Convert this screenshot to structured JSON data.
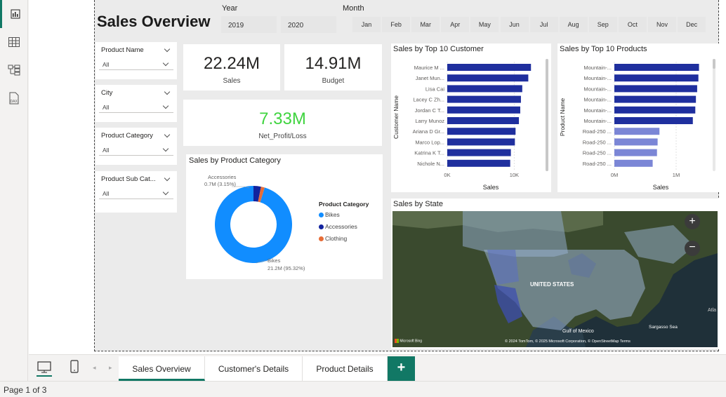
{
  "title": "Sales Overview",
  "year_filter": {
    "label": "Year",
    "options": [
      "2019",
      "2020"
    ]
  },
  "month_filter": {
    "label": "Month",
    "options": [
      "Jan",
      "Feb",
      "Mar",
      "Apr",
      "May",
      "Jun",
      "Jul",
      "Aug",
      "Sep",
      "Oct",
      "Nov",
      "Dec"
    ]
  },
  "slicers": [
    {
      "label": "Product Name",
      "value": "All"
    },
    {
      "label": "City",
      "value": "All"
    },
    {
      "label": "Product Category",
      "value": "All"
    },
    {
      "label": "Product Sub Cat...",
      "value": "All"
    }
  ],
  "kpis": {
    "sales": {
      "value": "22.24M",
      "label": "Sales"
    },
    "budget": {
      "value": "14.91M",
      "label": "Budget"
    },
    "profit": {
      "value": "7.33M",
      "label": "Net_Profit/Loss",
      "color": "#3fd43f"
    }
  },
  "donut": {
    "title": "Sales by Product Category",
    "legend_title": "Product Category",
    "label_accessories_name": "Accessories",
    "label_accessories_value": "0.7M (3.15%)",
    "label_bikes_name": "Bikes",
    "label_bikes_value": "21.2M (95.32%)"
  },
  "customer_chart": {
    "title": "Sales by Top 10 Customer"
  },
  "products_chart": {
    "title": "Sales by Top 10 Products"
  },
  "map": {
    "title": "Sales by State",
    "label_us": "UNITED STATES",
    "label_gulf": "Gulf of Mexico",
    "label_sargasso": "Sargasso Sea",
    "label_atl": "Atla",
    "attribution": "© 2024 TomTom, © 2025 Microsoft Corporation, © OpenStreetMap  Terms",
    "bing": "Microsoft Bing"
  },
  "tabs": [
    {
      "label": "Sales Overview",
      "active": true
    },
    {
      "label": "Customer's Details",
      "active": false
    },
    {
      "label": "Product Details",
      "active": false
    }
  ],
  "add_tab": "+",
  "status": {
    "page": "Page 1 of 3"
  },
  "colors": {
    "accent": "#117865",
    "bar_dark": "#1f2f9e",
    "bar_light": "#7b86d6",
    "bikes": "#118dff",
    "accessories": "#12239e",
    "clothing": "#e66c37"
  },
  "chart_data": [
    {
      "type": "bar",
      "title": "Sales by Top 10 Customer",
      "xlabel": "Sales",
      "ylabel": "Customer Name",
      "categories": [
        "Maurice M ...",
        "Janet Mun...",
        "Lisa Cai",
        "Lacey C Zh...",
        "Jordan C T...",
        "Larry Munoz",
        "Ariana D Gr...",
        "Marco Lop...",
        "Katrina K T...",
        "Nichole N..."
      ],
      "values": [
        12500,
        12100,
        11200,
        11000,
        10900,
        10700,
        10200,
        10100,
        9500,
        9400
      ],
      "xlim": [
        0,
        13000
      ],
      "xticks": [
        "0K",
        "10K"
      ]
    },
    {
      "type": "bar",
      "title": "Sales by Top 10 Products",
      "xlabel": "Sales",
      "ylabel": "Product Name",
      "categories": [
        "Mountain-...",
        "Mountain-...",
        "Mountain-...",
        "Mountain-...",
        "Mountain-...",
        "Mountain-...",
        "Road-250 ...",
        "Road-250 ...",
        "Road-250 ...",
        "Road-250 ..."
      ],
      "values": [
        1370000,
        1360000,
        1340000,
        1320000,
        1310000,
        1270000,
        730000,
        700000,
        690000,
        620000
      ],
      "xlim": [
        0,
        1500000
      ],
      "xticks": [
        "0M",
        "1M"
      ]
    },
    {
      "type": "pie",
      "title": "Sales by Product Category",
      "categories": [
        "Bikes",
        "Accessories",
        "Clothing"
      ],
      "values": [
        95.32,
        3.15,
        1.53
      ]
    }
  ]
}
